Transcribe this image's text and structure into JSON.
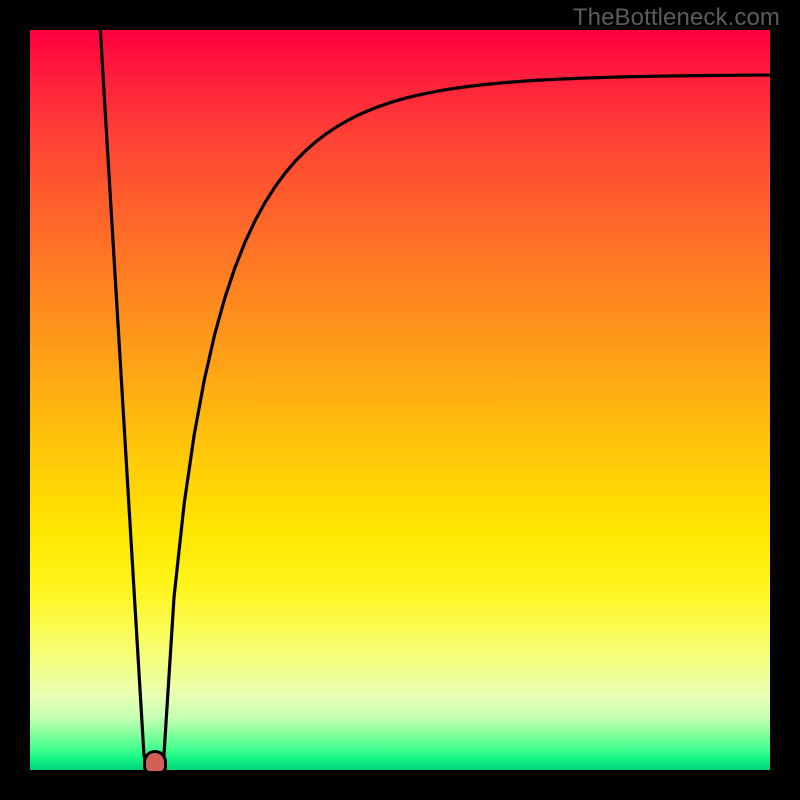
{
  "watermark": "TheBottleneck.com",
  "chart_data": {
    "type": "line",
    "title": "",
    "xlabel": "",
    "ylabel": "",
    "xlim": [
      0,
      1
    ],
    "ylim": [
      0,
      100
    ],
    "legend": false,
    "grid": false,
    "curves": [
      {
        "name": "left-descent",
        "x": [
          0.095,
          0.154
        ],
        "y": [
          100,
          2
        ],
        "shape": "linear"
      },
      {
        "name": "right-rise",
        "start_x": 0.181,
        "end_x": 1.0,
        "start_y": 2,
        "asymptote_y": 94,
        "shape": "log-like"
      }
    ],
    "trough": {
      "x": 0.167,
      "y": 0
    },
    "background": {
      "type": "vertical-gradient",
      "stops": [
        {
          "pos": 0,
          "meaning": "severe",
          "color": "#ff003e"
        },
        {
          "pos": 50,
          "meaning": "moderate",
          "color": "#ffbe0c"
        },
        {
          "pos": 85,
          "meaning": "mild",
          "color": "#f3ff88"
        },
        {
          "pos": 100,
          "meaning": "none",
          "color": "#00d27a"
        }
      ]
    }
  }
}
